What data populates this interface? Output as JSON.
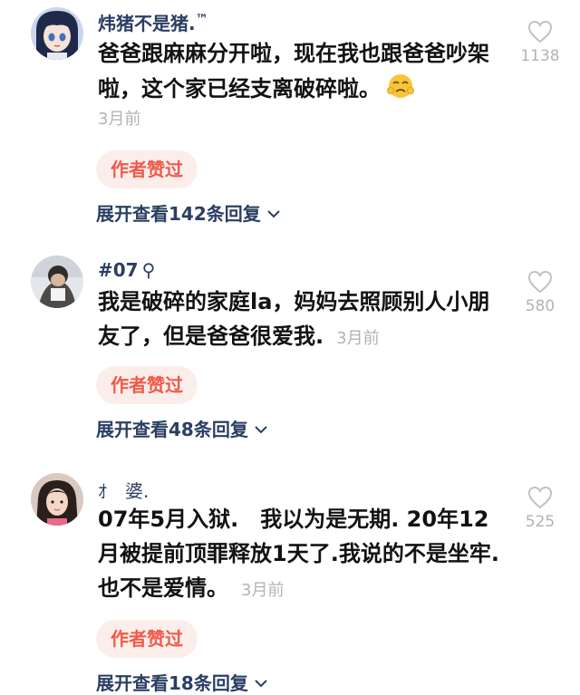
{
  "comments": [
    {
      "username": "炜猪不是猪.",
      "username_mark": "™",
      "text": "爸爸跟麻麻分开啦，现在我也跟爸爸吵架啦，这个家已经支离破碎啦。",
      "emoji_icon": "sad-face-emoji-icon",
      "time": "3月前",
      "badge": "作者赞过",
      "expand": "展开查看142条回复",
      "likes": "1138"
    },
    {
      "username": "#07",
      "username_mark": "⚲",
      "text": "我是破碎的家庭la，妈妈去照顾别人小朋友了，但是爸爸很爱我.",
      "time": "3月前",
      "badge": "作者赞过",
      "expand": "展开查看48条回复",
      "likes": "580"
    },
    {
      "username": "ｵ　婆.",
      "text": "07年5月入狱.　我以为是无期. 20年12月被提前顶罪释放1天了.我说的不是坐牢. 也不是爱情。",
      "time": "3月前",
      "badge": "作者赞过",
      "expand": "展开查看18条回复",
      "likes": "525"
    }
  ],
  "colors": {
    "username": "#2b3e63",
    "text": "#121212",
    "muted": "#b3b3b3",
    "badge_bg": "#fbeeea",
    "badge_text": "#ef5a4a"
  },
  "icons": {
    "like": "heart-outline-icon",
    "expand": "chevron-down-icon"
  }
}
